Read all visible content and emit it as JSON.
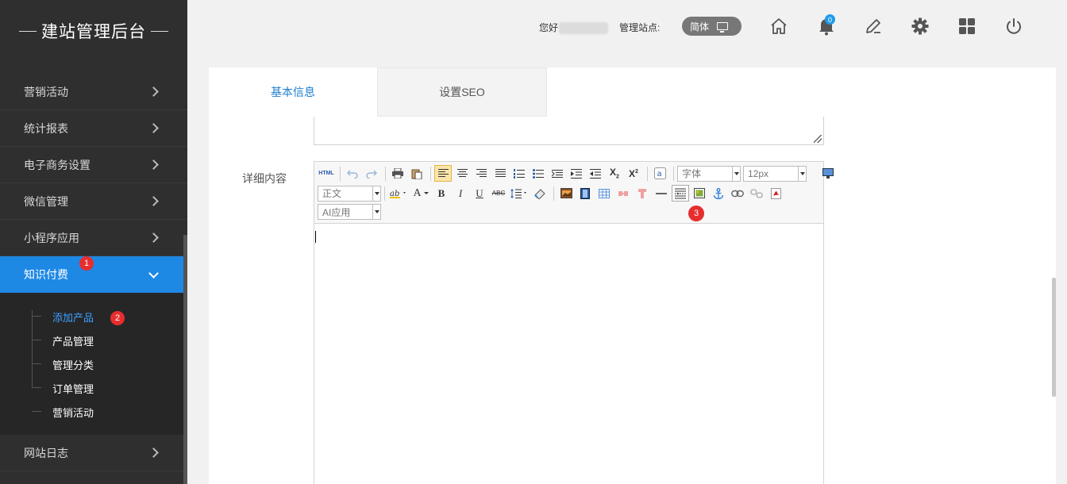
{
  "brand": {
    "title": "建站管理后台"
  },
  "sidebar": {
    "items": [
      {
        "label": "营销活动"
      },
      {
        "label": "统计报表"
      },
      {
        "label": "电子商务设置"
      },
      {
        "label": "微信管理"
      },
      {
        "label": "小程序应用"
      },
      {
        "label": "知识付费"
      },
      {
        "label": "网站日志"
      }
    ],
    "submenu": [
      {
        "label": "添加产品"
      },
      {
        "label": "产品管理"
      },
      {
        "label": "管理分类"
      },
      {
        "label": "订单管理"
      },
      {
        "label": "营销活动"
      }
    ],
    "step_badges": [
      "1",
      "2"
    ]
  },
  "header": {
    "greeting": "您好",
    "site_label": "管理站点:",
    "lang": "简体",
    "notification_count": "0",
    "icons": [
      "home-icon",
      "bell-icon",
      "edit-icon",
      "gear-icon",
      "apps-grid-icon",
      "power-icon"
    ]
  },
  "tabs": [
    {
      "label": "基本信息",
      "active": true
    },
    {
      "label": "设置SEO",
      "active": false
    }
  ],
  "form": {
    "detail_label": "详细内容"
  },
  "editor": {
    "html_btn": "HTML",
    "font_family": "字体",
    "font_size": "12px",
    "paragraph": "正文",
    "ai_app": "AI应用",
    "step_badge": "3",
    "bold": "B",
    "italic": "I",
    "underline": "U",
    "strike": "ABC",
    "font_color": "A"
  },
  "colors": {
    "sidebar_bg": "#2f2f2f",
    "accent": "#1e88e5",
    "badge_red": "#e62e2e"
  }
}
